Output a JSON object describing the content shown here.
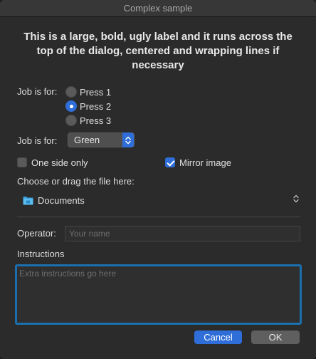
{
  "window": {
    "title": "Complex sample"
  },
  "headline": "This is a large, bold, ugly label and it runs across the top of the dialog, centered and wrapping lines if necessary",
  "job_radio": {
    "label": "Job is for:",
    "options": [
      "Press 1",
      "Press 2",
      "Press 3"
    ],
    "selected": "Press 2"
  },
  "job_popup": {
    "label": "Job is for:",
    "value": "Green"
  },
  "checkboxes": {
    "one_side": {
      "label": "One side only",
      "checked": false
    },
    "mirror": {
      "label": "Mirror image",
      "checked": true
    }
  },
  "file_chooser": {
    "label": "Choose or drag the file here:",
    "folder": "Documents",
    "folder_icon": "folder-icon"
  },
  "operator": {
    "label": "Operator:",
    "placeholder": "Your name",
    "value": ""
  },
  "instructions": {
    "label": "Instructions",
    "placeholder": "Extra instructions go here",
    "value": ""
  },
  "buttons": {
    "cancel": "Cancel",
    "ok": "OK"
  },
  "colors": {
    "accent": "#2f6ed8",
    "focus_ring": "#1b6fae",
    "window_bg": "#2b2b2b"
  }
}
